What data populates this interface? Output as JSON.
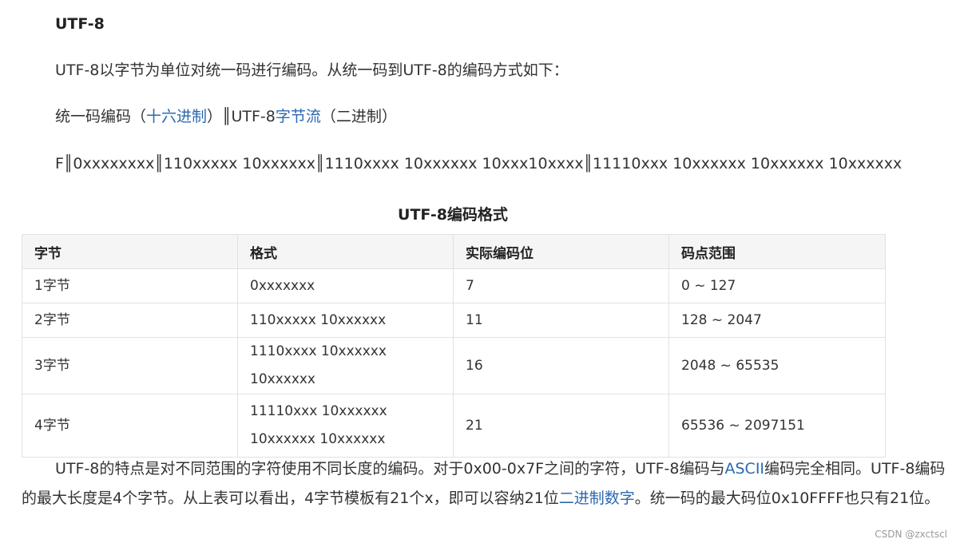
{
  "heading": "UTF-8",
  "intro": "UTF-8以字节为单位对统一码进行编码。从统一码到UTF-8的编码方式如下：",
  "mapping_line": {
    "part1": "统一码编码（",
    "link1": "十六进制",
    "part2": "）║UTF-8",
    "link2": "字节流",
    "part3": "（二进制）"
  },
  "pattern_line": "F║0xxxxxxxx║110xxxxx 10xxxxxx║1110xxxx 10xxxxxx 10xxx10xxxx║11110xxx 10xxxxxx 10xxxxxx 10xxxxxx",
  "table": {
    "caption": "UTF-8编码格式",
    "headers": [
      "字节",
      "格式",
      "实际编码位",
      "码点范围"
    ],
    "rows": [
      [
        "1字节",
        "0xxxxxxx",
        "7",
        "0 ~ 127"
      ],
      [
        "2字节",
        "110xxxxx 10xxxxxx",
        "11",
        "128 ~ 2047"
      ],
      [
        "3字节",
        "1110xxxx 10xxxxxx 10xxxxxx",
        "16",
        "2048 ~ 65535"
      ],
      [
        "4字节",
        "11110xxx 10xxxxxx 10xxxxxx 10xxxxxx",
        "21",
        "65536 ~ 2097151"
      ]
    ]
  },
  "conclusion": {
    "part1": "UTF-8的特点是对不同范围的字符使用不同长度的编码。对于0x00-0x7F之间的字符，UTF-8编码与",
    "link1": "ASCII",
    "part2": "编码完全相同。UTF-8编码的最大长度是4个字节。从上表可以看出，4字节模板有21个x，即可以容纳21位",
    "link2": "二进制数字",
    "part3": "。统一码的最大码位0x10FFFF也只有21位。"
  },
  "watermark": "CSDN @zxctscl",
  "colors": {
    "link": "#2c68b0",
    "header_bg": "#f5f5f5",
    "border": "#e2e2e2"
  }
}
